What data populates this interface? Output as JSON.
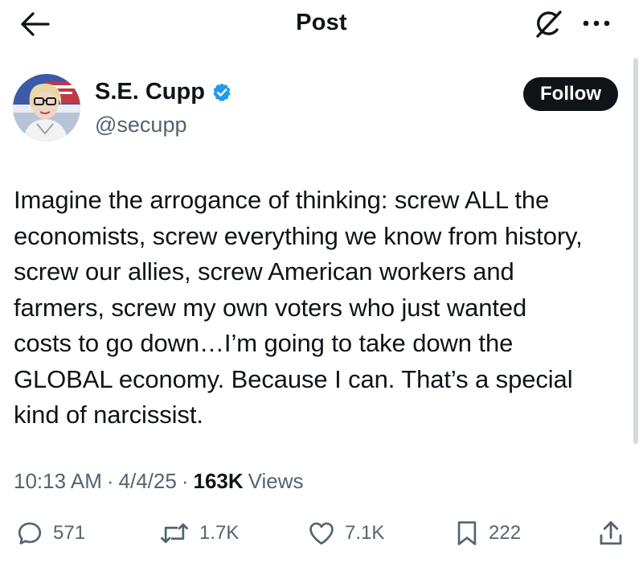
{
  "header": {
    "title": "Post",
    "back_icon": "arrow-left-icon",
    "grok_icon": "grok-icon",
    "more_icon": "more-dots-icon"
  },
  "author": {
    "name": "S.E. Cupp",
    "handle": "@secupp",
    "verified": true,
    "verified_color": "#1d9bf0",
    "follow_label": "Follow"
  },
  "tweet": {
    "text": "Imagine the arrogance of thinking: screw ALL the\neconomists, screw everything we know from history,\nscrew our allies, screw American workers and\nfarmers, screw my own voters who just wanted\ncosts to go down…I’m going to take down the\nGLOBAL economy. Because I can. That’s a special\nkind of narcissist."
  },
  "meta": {
    "time": "10:13 AM",
    "separator": "·",
    "date": "4/4/25",
    "views_count": "163K",
    "views_label": "Views"
  },
  "actions": {
    "replies": "571",
    "reposts": "1.7K",
    "likes": "7.1K",
    "bookmarks": "222"
  },
  "colors": {
    "text": "#0f1419",
    "secondary": "#536471",
    "follow_bg": "#0f1419",
    "accent": "#1d9bf0"
  }
}
